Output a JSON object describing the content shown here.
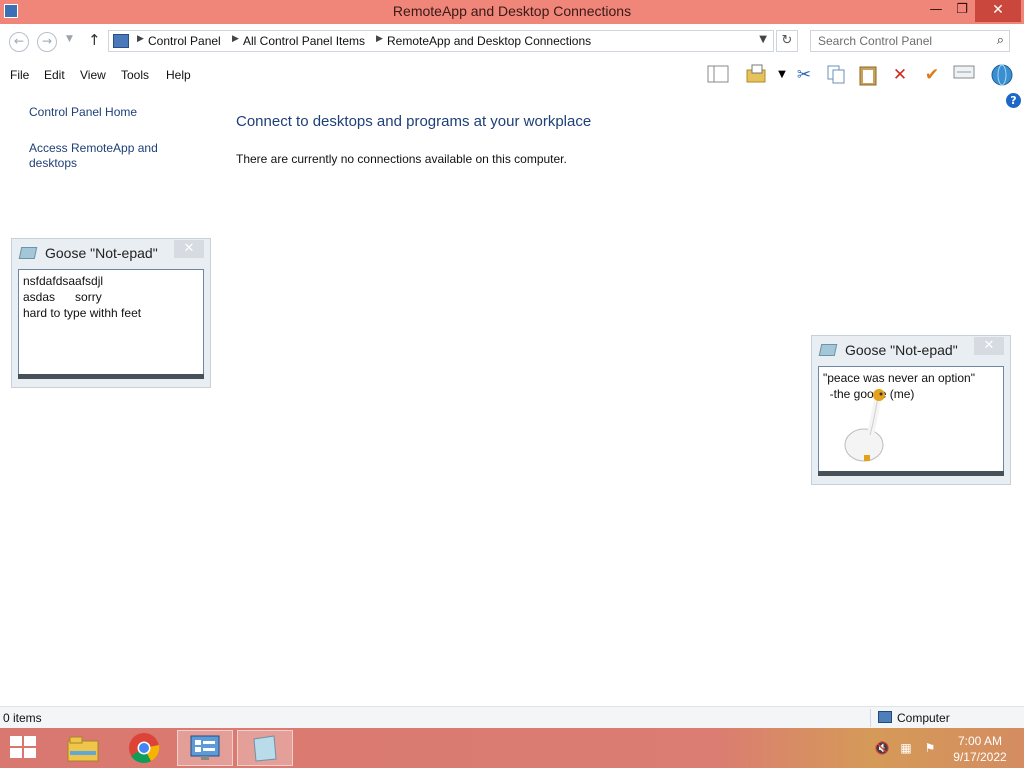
{
  "window": {
    "title": "RemoteApp and Desktop Connections",
    "minimize_glyph": "—",
    "maximize_glyph": "❐",
    "close_glyph": "✕"
  },
  "address_bar": {
    "breadcrumbs": [
      "Control Panel",
      "All Control Panel Items",
      "RemoteApp and Desktop Connections"
    ],
    "search_placeholder": "Search Control Panel"
  },
  "menu": [
    "File",
    "Edit",
    "View",
    "Tools",
    "Help"
  ],
  "toolbar_icons": [
    "layout-icon",
    "folder-options-icon",
    "dropdown-icon",
    "cut-icon",
    "copy-icon",
    "paste-icon",
    "delete-icon",
    "checkmark-icon",
    "properties-icon",
    "globe-icon"
  ],
  "left_nav": {
    "home": "Control Panel Home",
    "access_line1": "Access RemoteApp and",
    "access_line2": "desktops"
  },
  "main": {
    "heading": "Connect to desktops and programs at your workplace",
    "message": "There are currently no connections available on this computer."
  },
  "notepads": [
    {
      "title": "Goose \"Not-epad\"",
      "text": "nsfdafdsaafsdjl\nasdas      sorry\nhard to type withh feet"
    },
    {
      "title": "Goose \"Not-epad\"",
      "text": "\"peace was never an option\"\n  -the goose (me)"
    }
  ],
  "status_bar": {
    "item_count": "0 items",
    "location": "Computer"
  },
  "taskbar": {
    "apps": [
      "file-explorer",
      "chrome",
      "control-panel",
      "goose-notepad"
    ],
    "time": "7:00 AM",
    "date": "9/17/2022"
  },
  "colors": {
    "titlebar": "#f0857a",
    "link": "#1e3f78",
    "taskbar": "#d97870"
  }
}
